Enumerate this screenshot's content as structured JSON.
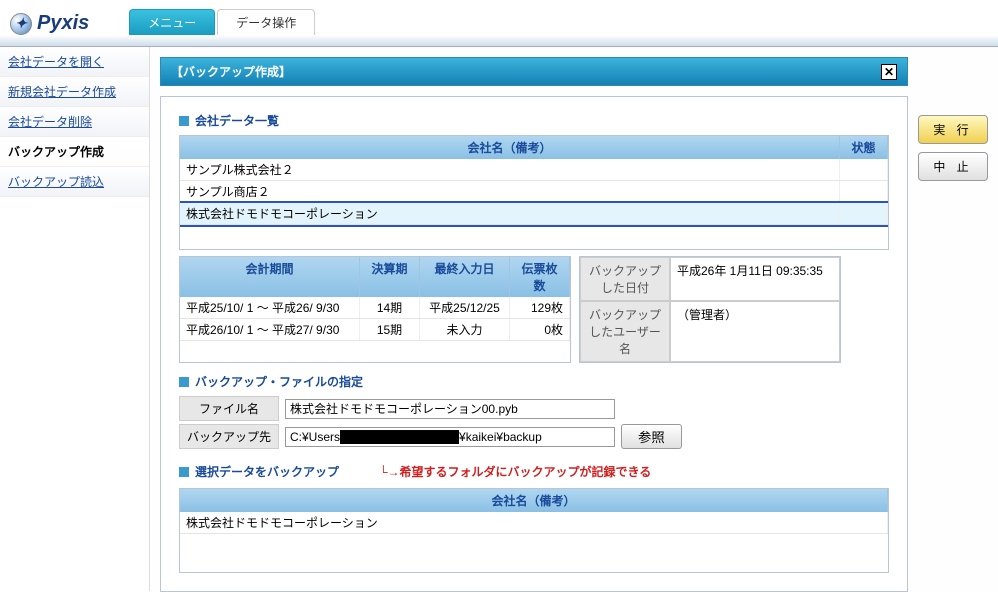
{
  "brand": "Pyxis",
  "tabs": {
    "menu": "メニュー",
    "data_ops": "データ操作"
  },
  "sidebar": {
    "items": [
      {
        "label": "会社データを開く"
      },
      {
        "label": "新規会社データ作成"
      },
      {
        "label": "会社データ削除"
      },
      {
        "label": "バックアップ作成"
      },
      {
        "label": "バックアップ読込"
      }
    ]
  },
  "panel": {
    "title": "【バックアップ作成】"
  },
  "company_list": {
    "heading": "会社データ一覧",
    "cols": {
      "name": "会社名（備考）",
      "status": "状態"
    },
    "rows": [
      {
        "name": "サンプル株式会社２",
        "status": ""
      },
      {
        "name": "サンプル商店２",
        "status": ""
      },
      {
        "name": "株式会社ドモドモコーポレーション",
        "status": ""
      }
    ]
  },
  "period": {
    "cols": {
      "period": "会計期間",
      "term": "決算期",
      "last": "最終入力日",
      "slips": "伝票枚数"
    },
    "rows": [
      {
        "period": "平成25/10/ 1 ～ 平成26/ 9/30",
        "term": "14期",
        "last": "平成25/12/25",
        "slips": "129枚"
      },
      {
        "period": "平成26/10/ 1 ～ 平成27/ 9/30",
        "term": "15期",
        "last": "未入力",
        "slips": "0枚"
      }
    ]
  },
  "backup_info": {
    "date_label": "バックアップした日付",
    "date_val": "平成26年 1月11日 09:35:35",
    "user_label": "バックアップしたユーザー名",
    "user_val": "（管理者）"
  },
  "file_spec": {
    "heading": "バックアップ・ファイルの指定",
    "file_label": "ファイル名",
    "file_val": "株式会社ドモドモコーポレーション00.pyb",
    "dest_label": "バックアップ先",
    "dest_val": "C:¥Users██████████████¥kaikei¥backup",
    "browse": "参照"
  },
  "hint": "└→希望するフォルダにバックアップが記録できる",
  "selected": {
    "heading": "選択データをバックアップ",
    "cols": {
      "name": "会社名（備考）"
    },
    "rows": [
      {
        "name": "株式会社ドモドモコーポレーション"
      }
    ]
  },
  "actions": {
    "execute": "実 行",
    "cancel": "中 止"
  }
}
